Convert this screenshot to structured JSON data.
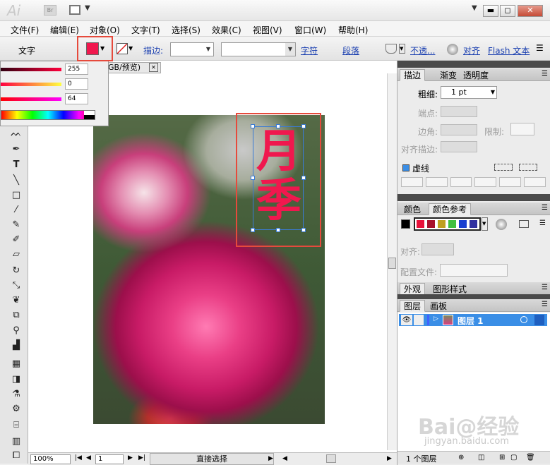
{
  "titlebar": {
    "app_logo": "Ai",
    "bridge_label": "Br",
    "layout_icon": "grid-layout-icon",
    "caret": "▼",
    "minimize": "▬",
    "restore": "◻",
    "close": "✕"
  },
  "menu": {
    "items": [
      "文件(F)",
      "编辑(E)",
      "对象(O)",
      "文字(T)",
      "选择(S)",
      "效果(C)",
      "视图(V)",
      "窗口(W)",
      "帮助(H)"
    ]
  },
  "control_bar": {
    "tool_name": "文字",
    "fill_color": "#f0184e",
    "stroke_label": "描边:",
    "char_link": "字符",
    "para_link": "段落",
    "opacity_link": "不透...",
    "align_link": "对齐",
    "flash_link": "Flash 文本"
  },
  "color_popup": {
    "r": "255",
    "g": "0",
    "b": "64"
  },
  "document": {
    "tab_title": "GB/预览)",
    "tab_close": "✕",
    "text_char_1": "月",
    "text_char_2": "季",
    "text_color": "#f0184e"
  },
  "statusbar": {
    "zoom": "100%",
    "page": "1",
    "tool_status": "直接选择"
  },
  "stroke_panel": {
    "tabs": [
      "描边",
      "渐变",
      "透明度"
    ],
    "weight_label": "粗细:",
    "weight_value": "1 pt",
    "cap_label": "端点:",
    "corner_label": "边角:",
    "limit_label": "限制:",
    "align_label": "对齐描边:",
    "dashed_label": "虚线"
  },
  "color_panel": {
    "tabs": [
      "颜色",
      "颜色参考"
    ],
    "align_label": "对齐:",
    "profile_label": "配置文件:",
    "harmony_colors": [
      "#e8103a",
      "#a8102c",
      "#c0a020",
      "#40c040",
      "#1a40d0",
      "#3030a0"
    ]
  },
  "appearance_panel": {
    "tabs": [
      "外观",
      "图形样式"
    ]
  },
  "layers_panel": {
    "tabs": [
      "图层",
      "画板"
    ],
    "layer_name": "图层 1",
    "layer_count": "1 个图层"
  },
  "watermark": {
    "main": "Bai@经验",
    "sub": "jingyan.baidu.com"
  }
}
